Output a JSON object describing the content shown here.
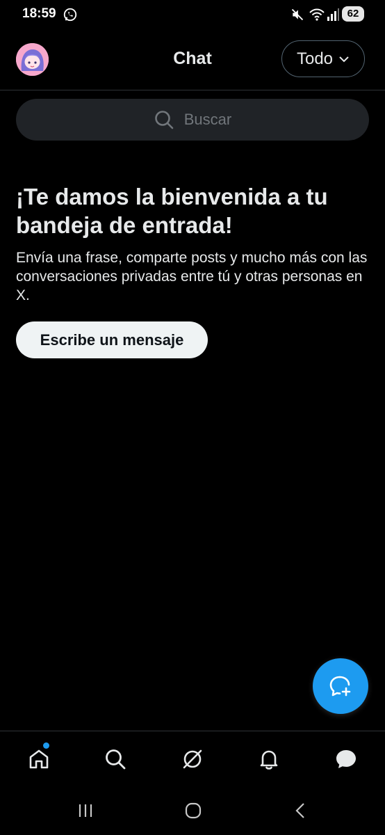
{
  "status_bar": {
    "time": "18:59",
    "battery": "62"
  },
  "header": {
    "title": "Chat",
    "filter_label": "Todo"
  },
  "search": {
    "placeholder": "Buscar"
  },
  "welcome": {
    "title": "¡Te damos la bienvenida a tu bandeja de entrada!",
    "description": "Envía una frase, comparte posts y mucho más con las conversaciones privadas entre tú y otras personas en X.",
    "button_label": "Escribe un mensaje"
  },
  "bottom_nav": {
    "items": [
      "home-icon",
      "search-icon",
      "grok-icon",
      "bell-icon",
      "messages-icon"
    ]
  },
  "colors": {
    "accent": "#1d9bf0",
    "background": "#000000",
    "text": "#e7e9ea"
  }
}
